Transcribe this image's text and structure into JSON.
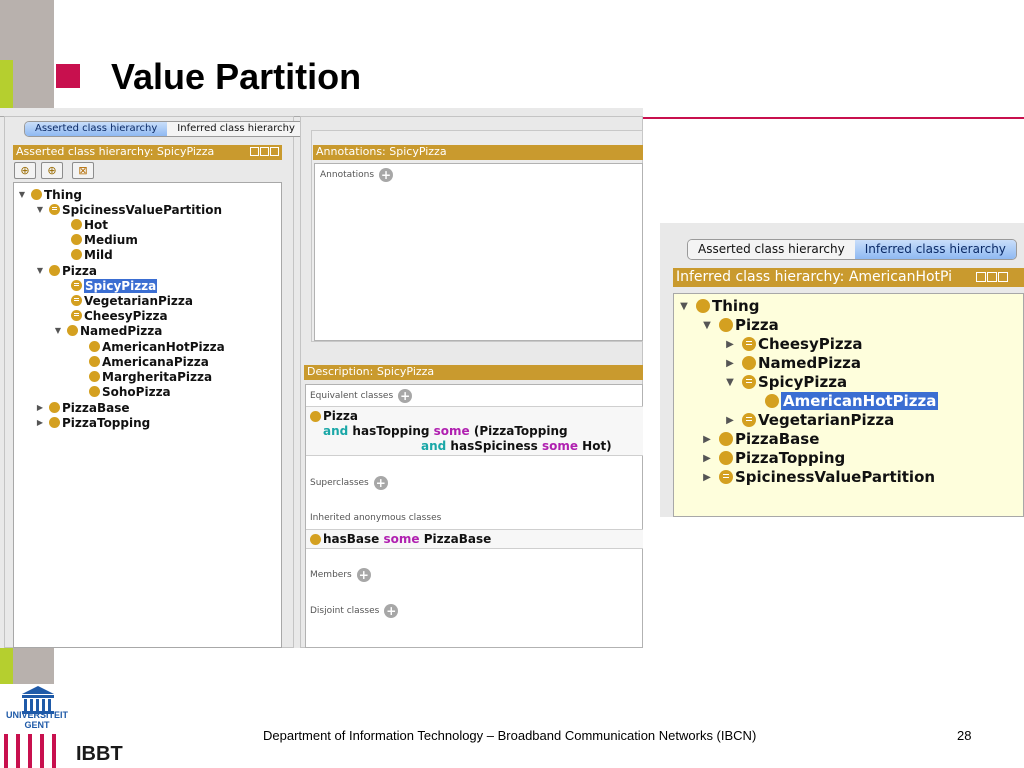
{
  "slide": {
    "title": "Value Partition",
    "footer": "Department of Information Technology – Broadband Communication Networks (IBCN)",
    "page_number": "28",
    "logo_university": "UNIVERSITEIT GENT",
    "logo_ibbt": "IBBT",
    "colors": {
      "accent_magenta": "#c8104e",
      "accent_green": "#b5cf2f",
      "accent_grey": "#b8b1ad"
    }
  },
  "left_window": {
    "tabs": [
      {
        "label": "Asserted class hierarchy",
        "active": true
      },
      {
        "label": "Inferred class hierarchy",
        "active": false
      }
    ],
    "hierarchy_title": "Asserted class hierarchy: SpicyPizza",
    "toolbar": [
      "add-subclass-icon",
      "add-sibling-icon",
      "delete-class-icon"
    ],
    "tree": [
      {
        "label": "Thing",
        "expanded": true,
        "equivalent": false
      },
      {
        "label": "SpicinessValuePartition",
        "expanded": true,
        "equivalent": true
      },
      {
        "label": "Hot",
        "equivalent": false
      },
      {
        "label": "Medium",
        "equivalent": false
      },
      {
        "label": "Mild",
        "equivalent": false
      },
      {
        "label": "Pizza",
        "expanded": true,
        "equivalent": false
      },
      {
        "label": "SpicyPizza",
        "equivalent": true,
        "selected": true
      },
      {
        "label": "VegetarianPizza",
        "equivalent": true
      },
      {
        "label": "CheesyPizza",
        "equivalent": true
      },
      {
        "label": "NamedPizza",
        "expanded": true,
        "equivalent": false
      },
      {
        "label": "AmericanHotPizza",
        "equivalent": false
      },
      {
        "label": "AmericanaPizza",
        "equivalent": false
      },
      {
        "label": "MargheritaPizza",
        "equivalent": false
      },
      {
        "label": "SohoPizza",
        "equivalent": false
      },
      {
        "label": "PizzaBase",
        "expanded": false,
        "equivalent": false
      },
      {
        "label": "PizzaTopping",
        "expanded": false,
        "equivalent": false
      }
    ],
    "annotations": {
      "title": "Annotations: SpicyPizza",
      "label": "Annotations"
    },
    "description": {
      "title": "Description: SpicyPizza",
      "equivalent_label": "Equivalent classes",
      "equivalent_expr": {
        "class": "Pizza",
        "and1": "and",
        "prop1": "hasTopping",
        "some1": "some",
        "filler1": "(PizzaTopping",
        "and2": "and",
        "prop2": "hasSpiciness",
        "some2": "some",
        "filler2": "Hot)"
      },
      "superclasses_label": "Superclasses",
      "inherited_label": "Inherited anonymous classes",
      "inherited_expr": {
        "prop": "hasBase",
        "some": "some",
        "filler": "PizzaBase"
      },
      "members_label": "Members",
      "disjoint_label": "Disjoint classes"
    }
  },
  "right_window": {
    "tabs": [
      {
        "label": "Asserted class hierarchy",
        "active": false
      },
      {
        "label": "Inferred class hierarchy",
        "active": true
      }
    ],
    "hierarchy_title": "Inferred class hierarchy: AmericanHotPi",
    "tree": [
      {
        "label": "Thing",
        "expanded": true,
        "equivalent": false
      },
      {
        "label": "Pizza",
        "expanded": true,
        "equivalent": false
      },
      {
        "label": "CheesyPizza",
        "expanded": false,
        "equivalent": true
      },
      {
        "label": "NamedPizza",
        "expanded": false,
        "equivalent": false
      },
      {
        "label": "SpicyPizza",
        "expanded": true,
        "equivalent": true
      },
      {
        "label": "AmericanHotPizza",
        "equivalent": false,
        "selected": true
      },
      {
        "label": "VegetarianPizza",
        "expanded": false,
        "equivalent": true
      },
      {
        "label": "PizzaBase",
        "expanded": false,
        "equivalent": false
      },
      {
        "label": "PizzaTopping",
        "expanded": false,
        "equivalent": false
      },
      {
        "label": "SpicinessValuePartition",
        "expanded": false,
        "equivalent": true
      }
    ]
  }
}
